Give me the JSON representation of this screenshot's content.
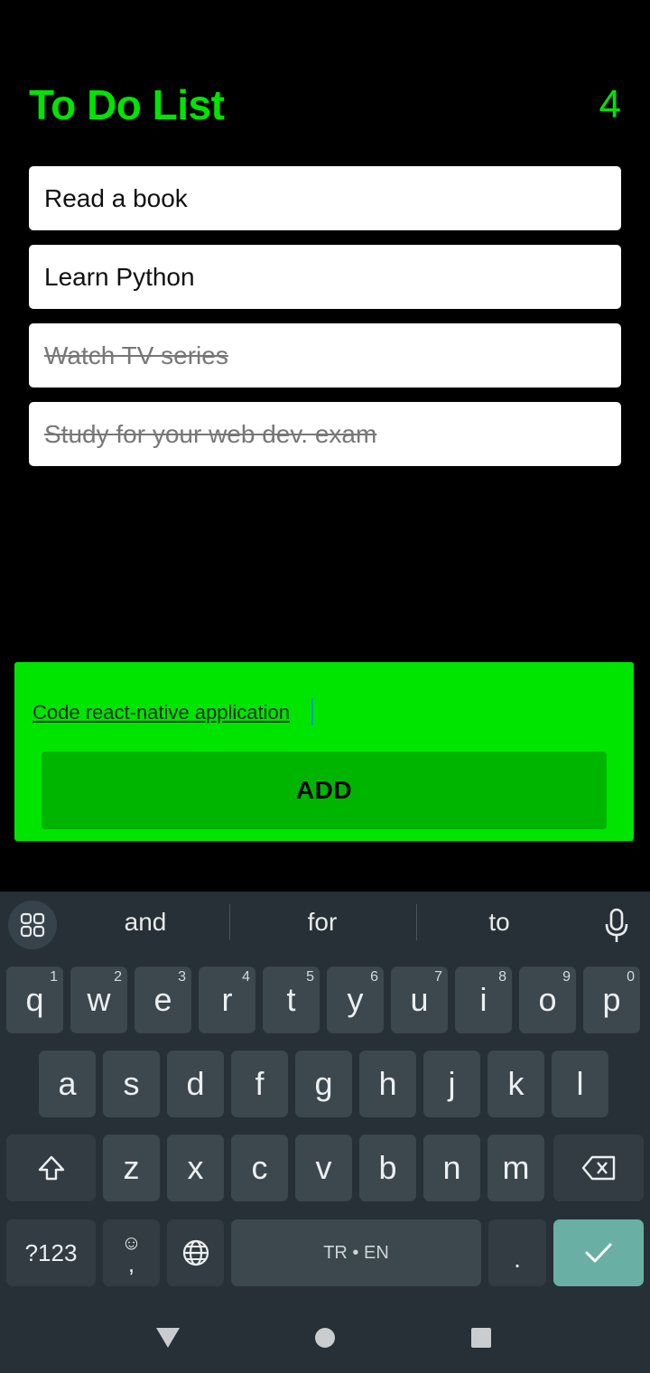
{
  "header": {
    "title": "To Do List",
    "count": "4"
  },
  "todos": [
    {
      "text": "Read a book",
      "done": false
    },
    {
      "text": "Learn Python",
      "done": false
    },
    {
      "text": "Watch TV series",
      "done": true
    },
    {
      "text": "Study for your web dev. exam",
      "done": true
    }
  ],
  "add_panel": {
    "input_value": "Code react-native application",
    "button_label": "ADD"
  },
  "keyboard": {
    "suggestions": [
      "and",
      "for",
      "to"
    ],
    "row1": [
      "q",
      "w",
      "e",
      "r",
      "t",
      "y",
      "u",
      "i",
      "o",
      "p"
    ],
    "row1_hints": [
      "1",
      "2",
      "3",
      "4",
      "5",
      "6",
      "7",
      "8",
      "9",
      "0"
    ],
    "row2": [
      "a",
      "s",
      "d",
      "f",
      "g",
      "h",
      "j",
      "k",
      "l"
    ],
    "row3": [
      "z",
      "x",
      "c",
      "v",
      "b",
      "n",
      "m"
    ],
    "symbols_label": "?123",
    "comma_label": ",",
    "space_label": "TR • EN",
    "period_label": "."
  },
  "colors": {
    "accent": "#00e400",
    "panel": "#00e500",
    "button": "#00b500",
    "enter": "#6aafa4"
  }
}
